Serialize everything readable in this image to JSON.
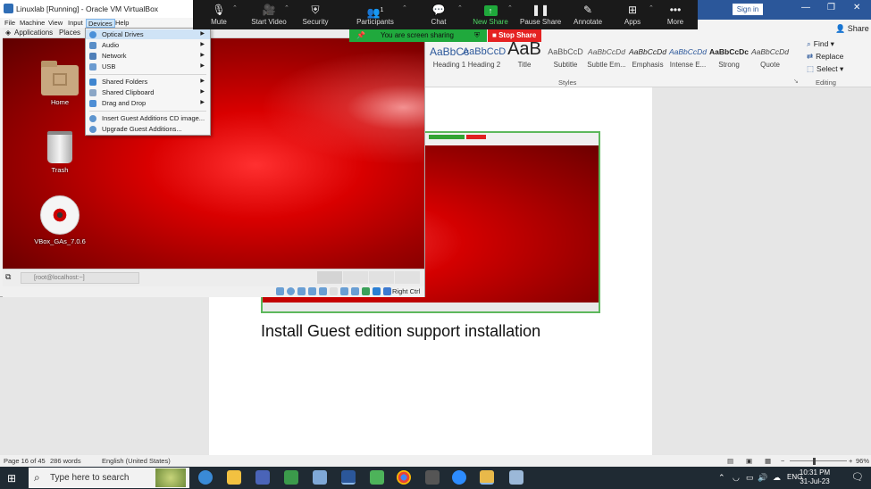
{
  "word": {
    "signin_label": "Sign in",
    "share_label": "Share",
    "styles": [
      {
        "preview": "AaBbCc",
        "label": "Heading 1"
      },
      {
        "preview": "AaBbCcD",
        "label": "Heading 2"
      },
      {
        "preview": "AaB",
        "label": "Title"
      },
      {
        "preview": "AaBbCcD",
        "label": "Subtitle"
      },
      {
        "preview": "AaBbCcDd",
        "label": "Subtle Em..."
      },
      {
        "preview": "AaBbCcDd",
        "label": "Emphasis"
      },
      {
        "preview": "AaBbCcDd",
        "label": "Intense E..."
      },
      {
        "preview": "AaBbCcDc",
        "label": "Strong"
      },
      {
        "preview": "AaBbCcDd",
        "label": "Quote"
      }
    ],
    "styles_group_label": "Styles",
    "editing": {
      "find": "Find",
      "replace": "Replace",
      "select": "Select",
      "group_label": "Editing"
    },
    "document_caption": "Install Guest edition support installation",
    "status": {
      "page": "Page 16 of 45",
      "words": "286 words",
      "language": "English (United States)",
      "zoom": "96%"
    }
  },
  "vbox": {
    "title": "Linuxlab [Running] - Oracle VM VirtualBox",
    "menus": [
      "File",
      "Machine",
      "View",
      "Input",
      "Devices",
      "Help"
    ],
    "active_menu": "Devices",
    "guest_topbar": {
      "applications": "Applications",
      "places": "Places"
    },
    "desktop_icons": [
      {
        "label": "Home",
        "icon": "home-folder-icon"
      },
      {
        "label": "Trash",
        "icon": "trash-icon"
      },
      {
        "label": "VBox_GAs_7.0.6",
        "icon": "cd-disc-icon"
      }
    ],
    "terminal_task": "[root@localhost:~]",
    "host_key_label": "Right Ctrl"
  },
  "devices_menu": {
    "items": [
      {
        "label": "Optical Drives",
        "submenu": true,
        "icon": "optical-drive-icon"
      },
      {
        "label": "Audio",
        "submenu": true,
        "icon": "audio-icon"
      },
      {
        "label": "Network",
        "submenu": true,
        "icon": "network-icon"
      },
      {
        "label": "USB",
        "submenu": true,
        "icon": "usb-icon"
      },
      {
        "label": "Shared Folders",
        "submenu": true,
        "icon": "shared-folders-icon"
      },
      {
        "label": "Shared Clipboard",
        "submenu": true,
        "icon": "clipboard-icon"
      },
      {
        "label": "Drag and Drop",
        "submenu": true,
        "icon": "drag-drop-icon"
      },
      {
        "label": "Insert Guest Additions CD image...",
        "submenu": false,
        "icon": "cd-insert-icon"
      },
      {
        "label": "Upgrade Guest Additions...",
        "submenu": false,
        "icon": "upgrade-icon"
      }
    ]
  },
  "zoom": {
    "buttons": [
      {
        "label": "Mute",
        "icon": "microphone-icon"
      },
      {
        "label": "Start Video",
        "icon": "video-off-icon"
      },
      {
        "label": "Security",
        "icon": "shield-icon"
      },
      {
        "label": "Participants",
        "icon": "participants-icon",
        "count": "1"
      },
      {
        "label": "Chat",
        "icon": "chat-icon"
      },
      {
        "label": "New Share",
        "icon": "share-screen-icon"
      },
      {
        "label": "Pause Share",
        "icon": "pause-icon"
      },
      {
        "label": "Annotate",
        "icon": "pen-icon"
      },
      {
        "label": "Apps",
        "icon": "apps-icon"
      },
      {
        "label": "More",
        "icon": "more-icon"
      }
    ],
    "sharing_banner": "You are screen sharing",
    "stop_share": "Stop Share"
  },
  "taskbar": {
    "search_placeholder": "Type here to search",
    "language": "ENG",
    "time": "10:31 PM",
    "date": "31-Jul-23"
  },
  "colors": {
    "word_blue": "#2b579a",
    "zoom_green": "#20a93d",
    "stop_red": "#e52222",
    "desktop_red": "#d90000"
  }
}
